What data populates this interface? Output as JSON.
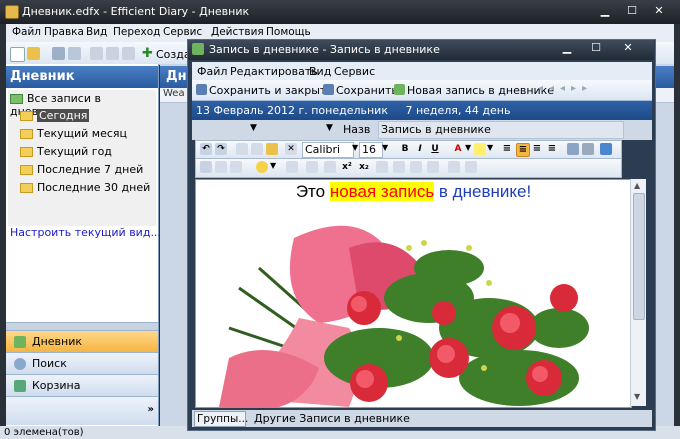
{
  "main_window": {
    "title": "Дневник.edfx - Efficient Diary - Дневник",
    "caption_buttons": [
      "min-icon",
      "max-icon",
      "close-icon"
    ],
    "menu": [
      "Файл",
      "Правка",
      "Вид",
      "Переход",
      "Сервис",
      "Действия",
      "Помощь"
    ],
    "toolbar_create_label": "Созда"
  },
  "sidebar": {
    "header": "Дневник",
    "tree": {
      "root": "Все записи в дневнике",
      "items": [
        "Сегодня",
        "Текущий месяц",
        "Текущий год",
        "Последние 7 дней",
        "Последние 30 дней"
      ],
      "selected_index": 0
    },
    "customize_link": "Настроить текущий вид...",
    "nav_buttons": [
      "Дневник",
      "Поиск",
      "Корзина"
    ],
    "active_nav": "Дневник"
  },
  "main_area": {
    "header": "Днев",
    "col_header_fragment": "Wea"
  },
  "status_bar": {
    "text": "0 элемена(тов)"
  },
  "dialog": {
    "title": "Запись в дневнике - Запись в дневнике",
    "menu": [
      "Файл",
      "Редактировать",
      "Вид",
      "Сервис"
    ],
    "toolbar": {
      "save_close": "Сохранить и закрыть",
      "save": "Сохранить",
      "new_entry": "Новая запись в дневнике"
    },
    "info_line": "13 Февраль 2012 г. понедельник     7 неделя, 44 день",
    "title_field_label": "Назв",
    "title_field_value": "Запись в дневнике",
    "format": {
      "font": "Calibri",
      "size": "16"
    },
    "content": {
      "part1": "Это ",
      "part2": "новая запись",
      "part3": " в дневнике!"
    },
    "footer": {
      "groups_button": "Группы...",
      "groups_value": "Другие Записи в дневнике"
    }
  }
}
